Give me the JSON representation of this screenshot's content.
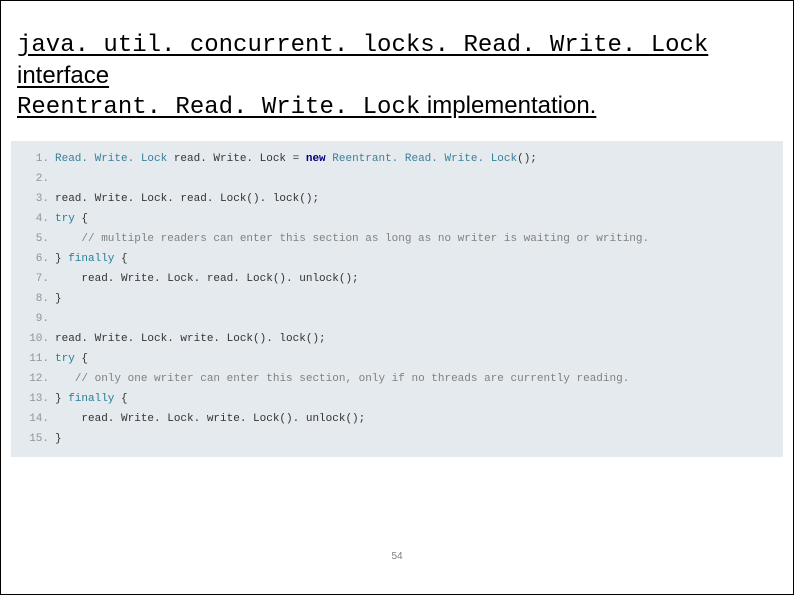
{
  "title": {
    "line1_mono": "java. util. concurrent. locks. Read. Write. Lock",
    "line1_rest": " interface",
    "line2_mono": "Reentrant. Read. Write. Lock",
    "line2_rest": " implementation. "
  },
  "code": {
    "lines": [
      {
        "n": "1.",
        "tokens": [
          {
            "cls": "tok-type",
            "t": "Read. Write. Lock"
          },
          {
            "cls": "tok-plain",
            "t": " read. Write. Lock = "
          },
          {
            "cls": "tok-new",
            "t": "new"
          },
          {
            "cls": "tok-plain",
            "t": " "
          },
          {
            "cls": "tok-type",
            "t": "Reentrant. Read. Write. Lock"
          },
          {
            "cls": "tok-plain",
            "t": "();"
          }
        ]
      },
      {
        "n": "2.",
        "tokens": [
          {
            "cls": "tok-plain",
            "t": " "
          }
        ]
      },
      {
        "n": "3.",
        "tokens": [
          {
            "cls": "tok-plain",
            "t": "read. Write. Lock. read. Lock(). lock();"
          }
        ]
      },
      {
        "n": "4.",
        "tokens": [
          {
            "cls": "tok-kw",
            "t": "try"
          },
          {
            "cls": "tok-plain",
            "t": " {"
          }
        ]
      },
      {
        "n": "5.",
        "tokens": [
          {
            "cls": "tok-plain",
            "t": "    "
          },
          {
            "cls": "tok-comment",
            "t": "// multiple readers can enter this section as long as no writer is waiting or writing."
          }
        ]
      },
      {
        "n": "6.",
        "tokens": [
          {
            "cls": "tok-plain",
            "t": "} "
          },
          {
            "cls": "tok-kw",
            "t": "finally"
          },
          {
            "cls": "tok-plain",
            "t": " {"
          }
        ]
      },
      {
        "n": "7.",
        "tokens": [
          {
            "cls": "tok-plain",
            "t": "    read. Write. Lock. read. Lock(). unlock();"
          }
        ]
      },
      {
        "n": "8.",
        "tokens": [
          {
            "cls": "tok-plain",
            "t": "}"
          }
        ]
      },
      {
        "n": "9.",
        "tokens": [
          {
            "cls": "tok-plain",
            "t": " "
          }
        ]
      },
      {
        "n": "10.",
        "tokens": [
          {
            "cls": "tok-plain",
            "t": "read. Write. Lock. write. Lock(). lock();"
          }
        ]
      },
      {
        "n": "11.",
        "tokens": [
          {
            "cls": "tok-kw",
            "t": "try"
          },
          {
            "cls": "tok-plain",
            "t": " {"
          }
        ]
      },
      {
        "n": "12.",
        "tokens": [
          {
            "cls": "tok-plain",
            "t": "   "
          },
          {
            "cls": "tok-comment",
            "t": "// only one writer can enter this section, only if no threads are currently reading."
          }
        ]
      },
      {
        "n": "13.",
        "tokens": [
          {
            "cls": "tok-plain",
            "t": "} "
          },
          {
            "cls": "tok-kw",
            "t": "finally"
          },
          {
            "cls": "tok-plain",
            "t": " {"
          }
        ]
      },
      {
        "n": "14.",
        "tokens": [
          {
            "cls": "tok-plain",
            "t": "    read. Write. Lock. write. Lock(). unlock();"
          }
        ]
      },
      {
        "n": "15.",
        "tokens": [
          {
            "cls": "tok-plain",
            "t": "}"
          }
        ]
      }
    ]
  },
  "page_number": "54"
}
